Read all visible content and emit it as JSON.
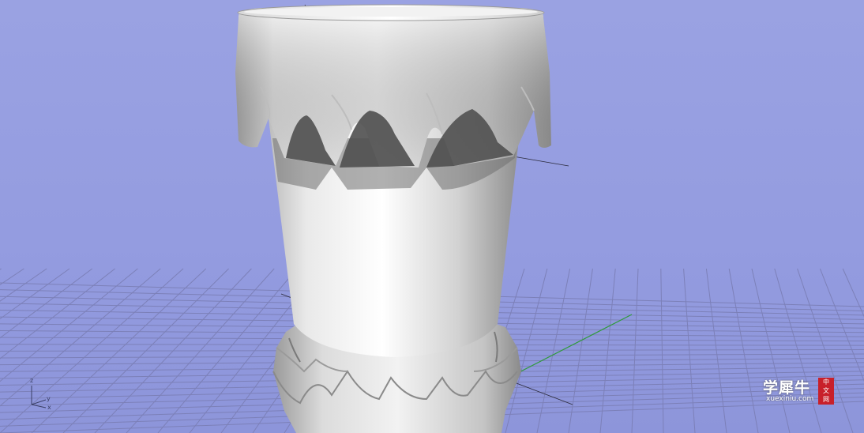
{
  "viewport": {
    "background_color": "#949ce0",
    "grid_color": "#7c80b8",
    "model_color": "#e2e2e2"
  },
  "axis_triad": {
    "z_label": "z",
    "y_label": "y",
    "x_label": "x",
    "icon": "axis-triad-icon"
  },
  "watermark": {
    "main_text": "学犀牛",
    "sub_text": "xuexiniu.com",
    "seal_chars": [
      "中",
      "文",
      "网"
    ],
    "seal_color": "#c8202a"
  }
}
